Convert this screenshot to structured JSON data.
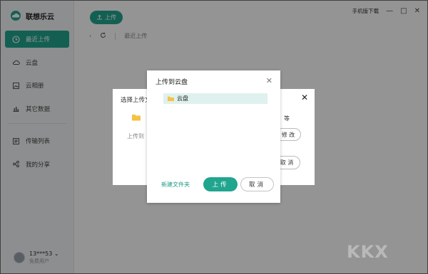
{
  "app": {
    "name": "联想乐云"
  },
  "sidebar": {
    "items": [
      {
        "label": "最近上传",
        "icon": "clock-icon"
      },
      {
        "label": "云盘",
        "icon": "cloud-icon"
      },
      {
        "label": "云相册",
        "icon": "photo-icon"
      },
      {
        "label": "其它数据",
        "icon": "chart-icon"
      },
      {
        "label": "传输列表",
        "icon": "list-icon"
      },
      {
        "label": "我的分享",
        "icon": "share-icon"
      }
    ]
  },
  "user": {
    "name": "13***53",
    "level": "免费用户"
  },
  "toolbar": {
    "upload_label": "上传",
    "mobile_download": "手机版下载"
  },
  "breadcrumb": {
    "current": "最近上传"
  },
  "select_dialog": {
    "title": "选择上传文",
    "suffix_text": "等",
    "upload_to_label": "上传到",
    "modify_label": "修 改",
    "cancel_label": "取 消"
  },
  "upload_dialog": {
    "title": "上传到云盘",
    "folder_name": "云盘",
    "new_folder": "新建文件夹",
    "upload_label": "上传",
    "cancel_label": "取消"
  },
  "watermark": "KKX",
  "colors": {
    "accent": "#21a58f",
    "selected_row": "#dff1ee"
  }
}
